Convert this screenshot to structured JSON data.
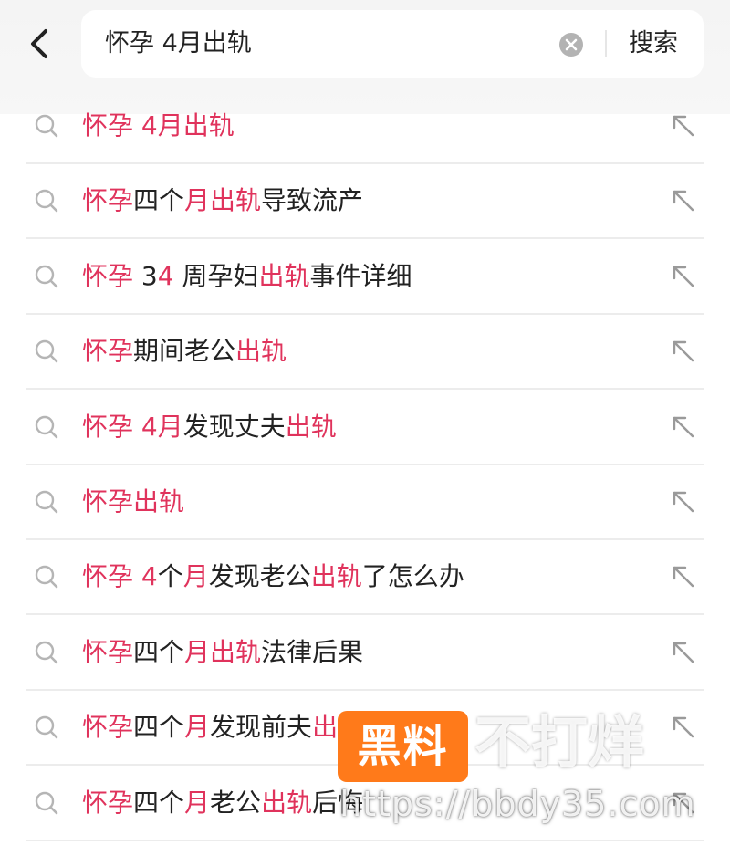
{
  "search": {
    "query": "怀孕 4月出轨",
    "submit_label": "搜索"
  },
  "suggestions": [
    {
      "parts": [
        {
          "t": "怀孕 4月出轨",
          "h": true
        }
      ]
    },
    {
      "parts": [
        {
          "t": "怀孕",
          "h": true
        },
        {
          "t": "四个",
          "h": false
        },
        {
          "t": "月出轨",
          "h": true
        },
        {
          "t": "导致流产",
          "h": false
        }
      ]
    },
    {
      "parts": [
        {
          "t": "怀孕",
          "h": true
        },
        {
          "t": " 3",
          "h": false
        },
        {
          "t": "4",
          "h": true
        },
        {
          "t": " 周孕妇",
          "h": false
        },
        {
          "t": "出轨",
          "h": true
        },
        {
          "t": "事件详细",
          "h": false
        }
      ]
    },
    {
      "parts": [
        {
          "t": "怀孕",
          "h": true
        },
        {
          "t": "期间老公",
          "h": false
        },
        {
          "t": "出轨",
          "h": true
        }
      ]
    },
    {
      "parts": [
        {
          "t": "怀孕 4月",
          "h": true
        },
        {
          "t": "发现丈夫",
          "h": false
        },
        {
          "t": "出轨",
          "h": true
        }
      ]
    },
    {
      "parts": [
        {
          "t": "怀孕出轨",
          "h": true
        }
      ]
    },
    {
      "parts": [
        {
          "t": "怀孕 4",
          "h": true
        },
        {
          "t": "个",
          "h": false
        },
        {
          "t": "月",
          "h": true
        },
        {
          "t": "发现老公",
          "h": false
        },
        {
          "t": "出轨",
          "h": true
        },
        {
          "t": "了怎么办",
          "h": false
        }
      ]
    },
    {
      "parts": [
        {
          "t": "怀孕",
          "h": true
        },
        {
          "t": "四个",
          "h": false
        },
        {
          "t": "月出轨",
          "h": true
        },
        {
          "t": "法律后果",
          "h": false
        }
      ]
    },
    {
      "parts": [
        {
          "t": "怀孕",
          "h": true
        },
        {
          "t": "四个",
          "h": false
        },
        {
          "t": "月",
          "h": true
        },
        {
          "t": "发现前夫",
          "h": false
        },
        {
          "t": "出轨",
          "h": true
        }
      ]
    },
    {
      "parts": [
        {
          "t": "怀孕",
          "h": true
        },
        {
          "t": "四个",
          "h": false
        },
        {
          "t": "月",
          "h": true
        },
        {
          "t": "老公",
          "h": false
        },
        {
          "t": "出轨",
          "h": true
        },
        {
          "t": "后悔",
          "h": false
        }
      ]
    }
  ],
  "watermark": {
    "box_text": "黑料",
    "text": "不打烊",
    "url": "https://bbdy35.com"
  },
  "colors": {
    "highlight": "#e0335c",
    "text": "#222222",
    "icon": "#b5b5b5",
    "watermark_box": "#ff7a1a"
  },
  "icons": {
    "back": "chevron-left-icon",
    "clear": "clear-circle-icon",
    "suggestion": "search-icon",
    "fill_query": "arrow-up-left-icon"
  }
}
